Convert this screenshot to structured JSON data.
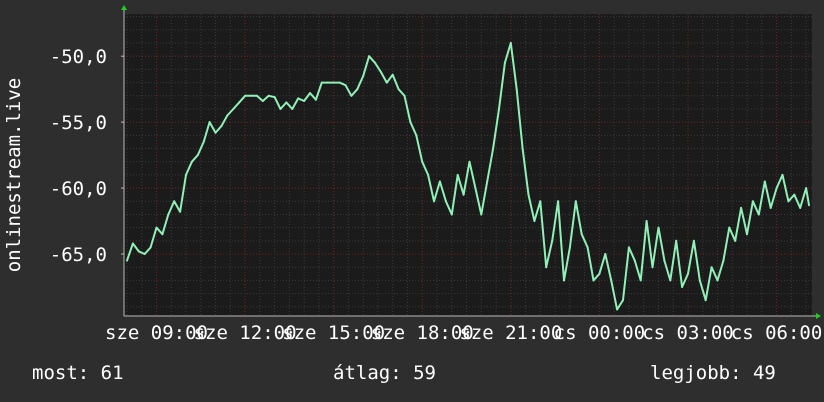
{
  "chart_data": {
    "type": "line",
    "ylabel": "onlinestream.live",
    "ylim": [
      -69.7,
      -46.8
    ],
    "yticks": [
      -65,
      -60,
      -55,
      -50
    ],
    "ytick_labels": [
      "-65,0",
      "-60,0",
      "-55,0",
      "-50,0"
    ],
    "xlim": [
      7.9,
      31.2
    ],
    "xticks": [
      9,
      12,
      15,
      18,
      21,
      24,
      27,
      30
    ],
    "xtick_labels": [
      "sze 09:00",
      "sze 12:00",
      "sze 15:00",
      "sze 18:00",
      "sze 21:00",
      "cs 00:00",
      "cs 03:00",
      "cs 06:00"
    ],
    "grid": true,
    "colors": {
      "background": "#2e2e2e",
      "plot_background": "#1b1b1b",
      "grid_major": "#6e2222",
      "grid_minor": "#3a3a3a",
      "line": "#90f0b8",
      "axis_arrow": "#22cc22"
    },
    "series": [
      {
        "name": "",
        "x": [
          8.0,
          8.2,
          8.4,
          8.6,
          8.8,
          9.0,
          9.2,
          9.4,
          9.6,
          9.8,
          10.0,
          10.2,
          10.4,
          10.6,
          10.8,
          11.0,
          11.2,
          11.4,
          11.6,
          11.8,
          12.0,
          12.2,
          12.4,
          12.6,
          12.8,
          13.0,
          13.2,
          13.4,
          13.6,
          13.8,
          14.0,
          14.2,
          14.4,
          14.6,
          14.8,
          15.0,
          15.2,
          15.4,
          15.6,
          15.8,
          16.0,
          16.2,
          16.4,
          16.6,
          16.8,
          17.0,
          17.2,
          17.4,
          17.6,
          17.8,
          18.0,
          18.2,
          18.4,
          18.6,
          18.8,
          19.0,
          19.2,
          19.4,
          19.6,
          19.8,
          20.0,
          20.2,
          20.4,
          20.6,
          20.8,
          21.0,
          21.2,
          21.4,
          21.6,
          21.8,
          22.0,
          22.2,
          22.4,
          22.6,
          22.8,
          23.0,
          23.2,
          23.4,
          23.6,
          23.8,
          24.0,
          24.2,
          24.4,
          24.6,
          24.8,
          25.0,
          25.2,
          25.4,
          25.6,
          25.8,
          26.0,
          26.2,
          26.4,
          26.6,
          26.8,
          27.0,
          27.2,
          27.4,
          27.6,
          27.8,
          28.0,
          28.2,
          28.4,
          28.6,
          28.8,
          29.0,
          29.2,
          29.4,
          29.6,
          29.8,
          30.0,
          30.2,
          30.4,
          30.6,
          30.8,
          31.0,
          31.1
        ],
        "y": [
          -65.5,
          -64.2,
          -64.8,
          -65.0,
          -64.5,
          -63.0,
          -63.5,
          -62.0,
          -61.0,
          -61.8,
          -59.0,
          -58.0,
          -57.5,
          -56.5,
          -55.0,
          -55.8,
          -55.3,
          -54.5,
          -54.0,
          -53.5,
          -53.0,
          -53.0,
          -53.0,
          -53.4,
          -53.0,
          -53.1,
          -54.0,
          -53.5,
          -54.0,
          -53.2,
          -53.4,
          -52.8,
          -53.3,
          -52.0,
          -52.0,
          -52.0,
          -52.0,
          -52.2,
          -53.0,
          -52.5,
          -51.5,
          -50.0,
          -50.5,
          -51.2,
          -52.0,
          -51.4,
          -52.5,
          -53.0,
          -55.0,
          -56.0,
          -58.0,
          -59.0,
          -61.0,
          -59.5,
          -61.0,
          -62.0,
          -59.0,
          -60.5,
          -58.0,
          -60.0,
          -62.0,
          -59.5,
          -57.0,
          -54.0,
          -50.5,
          -49.0,
          -52.5,
          -57.0,
          -60.5,
          -62.5,
          -61.0,
          -66.0,
          -64.0,
          -61.0,
          -67.0,
          -64.5,
          -61.0,
          -63.5,
          -64.5,
          -67.0,
          -66.5,
          -65.0,
          -67.0,
          -69.2,
          -68.5,
          -64.5,
          -65.5,
          -67.0,
          -62.5,
          -66.0,
          -63.0,
          -65.5,
          -67.0,
          -64.0,
          -67.5,
          -66.5,
          -64.0,
          -67.0,
          -68.5,
          -66.0,
          -67.0,
          -65.5,
          -63.0,
          -64.0,
          -61.5,
          -63.5,
          -61.0,
          -62.0,
          -59.5,
          -61.5,
          -60.0,
          -59.0,
          -61.0,
          -60.5,
          -61.5,
          -60.0,
          -61.3
        ]
      }
    ]
  },
  "stats": {
    "current": "most: 61",
    "average": "átlag: 59",
    "best": "legjobb: 49"
  }
}
